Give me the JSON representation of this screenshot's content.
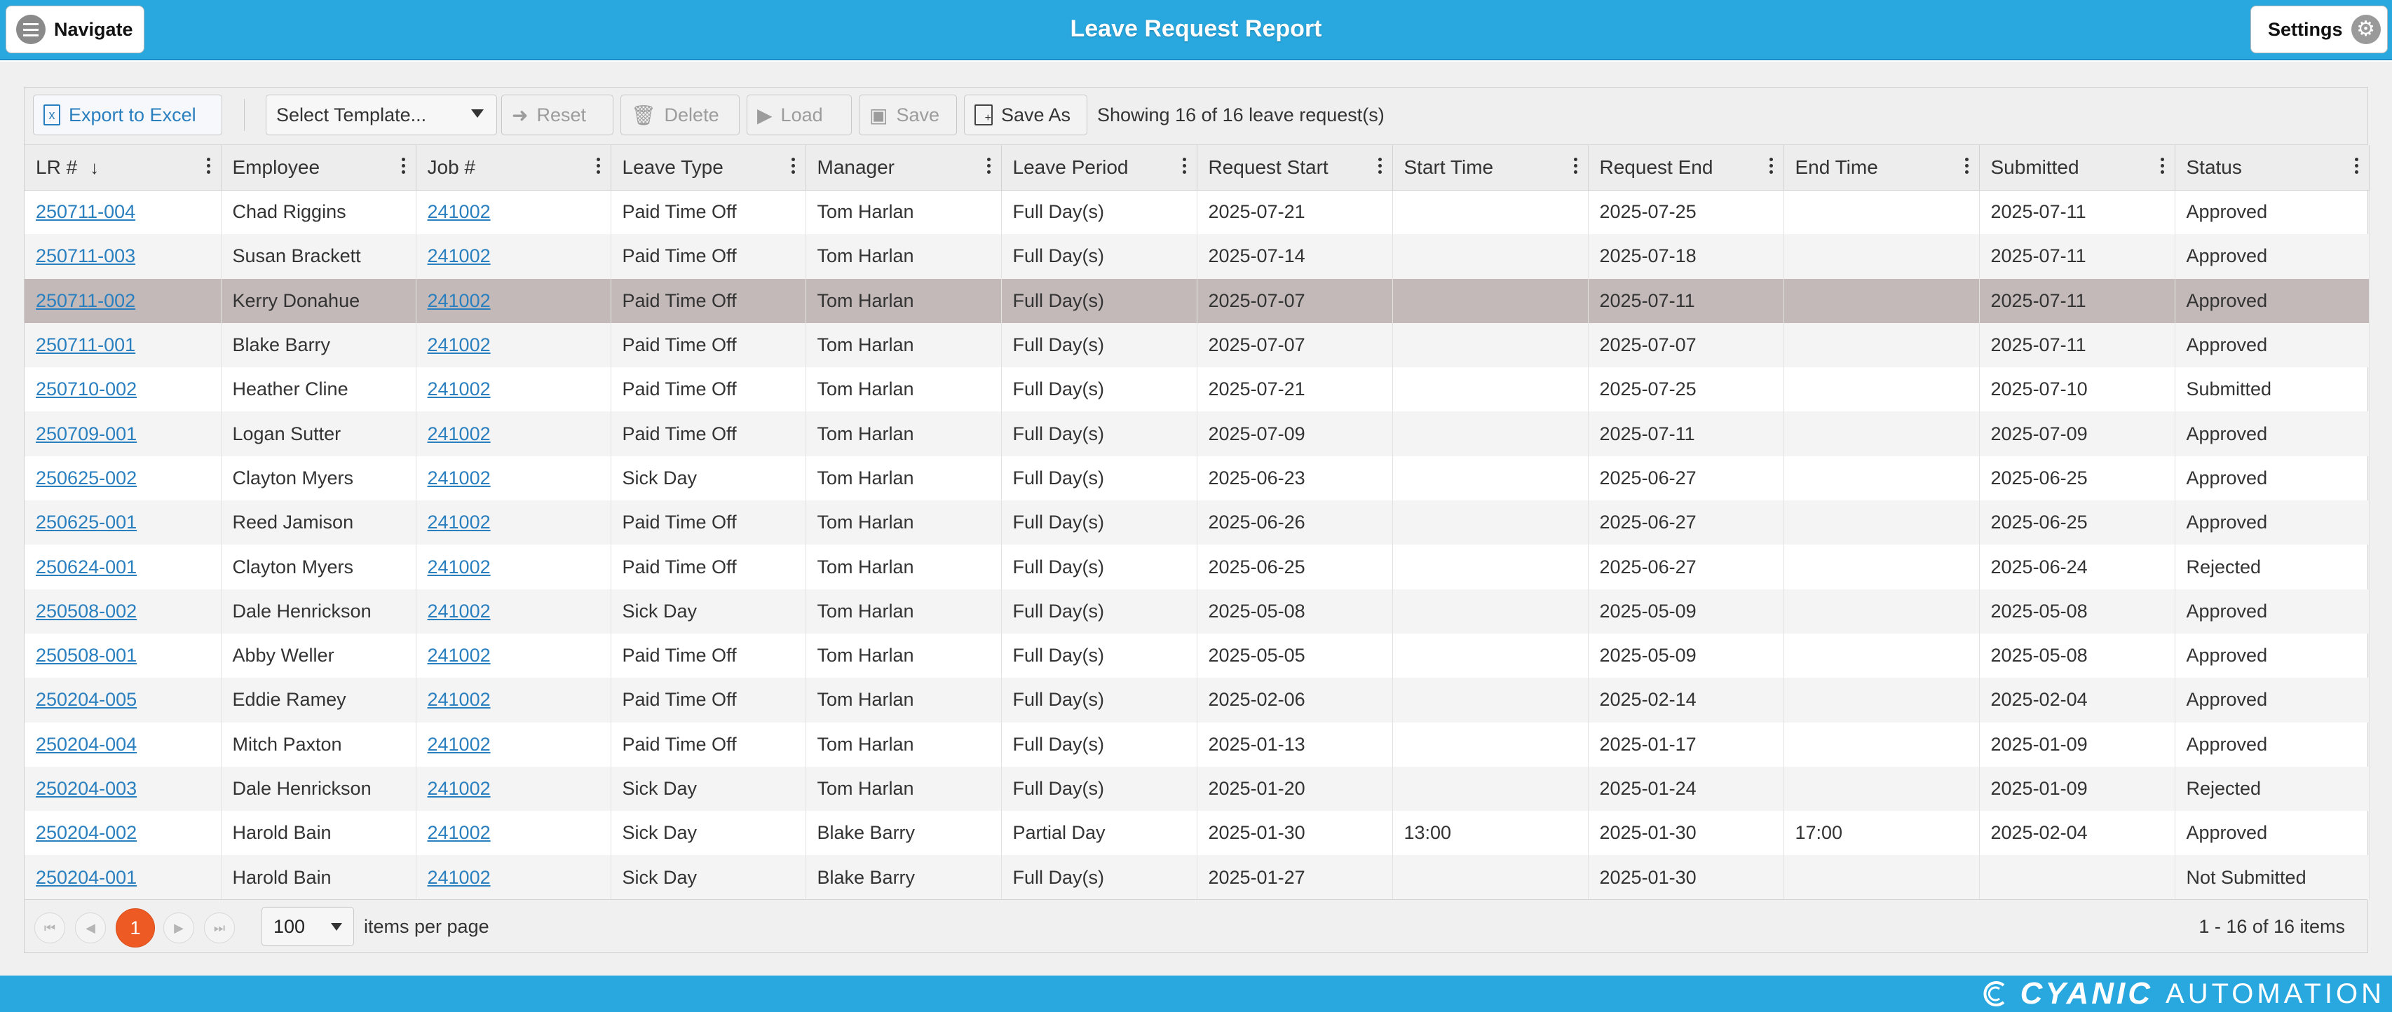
{
  "header": {
    "title": "Leave Request Report",
    "navigate_label": "Navigate",
    "settings_label": "Settings"
  },
  "toolbar": {
    "export_label": "Export to Excel",
    "template_placeholder": "Select Template...",
    "reset_label": "Reset",
    "delete_label": "Delete",
    "load_label": "Load",
    "save_label": "Save",
    "save_as_label": "Save As",
    "showing_text": "Showing 16 of 16 leave request(s)"
  },
  "columns": [
    "LR #",
    "Employee",
    "Job #",
    "Leave Type",
    "Manager",
    "Leave Period",
    "Request Start",
    "Start Time",
    "Request End",
    "End Time",
    "Submitted",
    "Status"
  ],
  "rows": [
    [
      "250711-004",
      "Chad Riggins",
      "241002",
      "Paid Time Off",
      "Tom Harlan",
      "Full Day(s)",
      "2025-07-21",
      "",
      "2025-07-25",
      "",
      "2025-07-11",
      "Approved"
    ],
    [
      "250711-003",
      "Susan Brackett",
      "241002",
      "Paid Time Off",
      "Tom Harlan",
      "Full Day(s)",
      "2025-07-14",
      "",
      "2025-07-18",
      "",
      "2025-07-11",
      "Approved"
    ],
    [
      "250711-002",
      "Kerry Donahue",
      "241002",
      "Paid Time Off",
      "Tom Harlan",
      "Full Day(s)",
      "2025-07-07",
      "",
      "2025-07-11",
      "",
      "2025-07-11",
      "Approved"
    ],
    [
      "250711-001",
      "Blake Barry",
      "241002",
      "Paid Time Off",
      "Tom Harlan",
      "Full Day(s)",
      "2025-07-07",
      "",
      "2025-07-07",
      "",
      "2025-07-11",
      "Approved"
    ],
    [
      "250710-002",
      "Heather Cline",
      "241002",
      "Paid Time Off",
      "Tom Harlan",
      "Full Day(s)",
      "2025-07-21",
      "",
      "2025-07-25",
      "",
      "2025-07-10",
      "Submitted"
    ],
    [
      "250709-001",
      "Logan Sutter",
      "241002",
      "Paid Time Off",
      "Tom Harlan",
      "Full Day(s)",
      "2025-07-09",
      "",
      "2025-07-11",
      "",
      "2025-07-09",
      "Approved"
    ],
    [
      "250625-002",
      "Clayton Myers",
      "241002",
      "Sick Day",
      "Tom Harlan",
      "Full Day(s)",
      "2025-06-23",
      "",
      "2025-06-27",
      "",
      "2025-06-25",
      "Approved"
    ],
    [
      "250625-001",
      "Reed Jamison",
      "241002",
      "Paid Time Off",
      "Tom Harlan",
      "Full Day(s)",
      "2025-06-26",
      "",
      "2025-06-27",
      "",
      "2025-06-25",
      "Approved"
    ],
    [
      "250624-001",
      "Clayton Myers",
      "241002",
      "Paid Time Off",
      "Tom Harlan",
      "Full Day(s)",
      "2025-06-25",
      "",
      "2025-06-27",
      "",
      "2025-06-24",
      "Rejected"
    ],
    [
      "250508-002",
      "Dale Henrickson",
      "241002",
      "Sick Day",
      "Tom Harlan",
      "Full Day(s)",
      "2025-05-08",
      "",
      "2025-05-09",
      "",
      "2025-05-08",
      "Approved"
    ],
    [
      "250508-001",
      "Abby Weller",
      "241002",
      "Paid Time Off",
      "Tom Harlan",
      "Full Day(s)",
      "2025-05-05",
      "",
      "2025-05-09",
      "",
      "2025-05-08",
      "Approved"
    ],
    [
      "250204-005",
      "Eddie Ramey",
      "241002",
      "Paid Time Off",
      "Tom Harlan",
      "Full Day(s)",
      "2025-02-06",
      "",
      "2025-02-14",
      "",
      "2025-02-04",
      "Approved"
    ],
    [
      "250204-004",
      "Mitch Paxton",
      "241002",
      "Paid Time Off",
      "Tom Harlan",
      "Full Day(s)",
      "2025-01-13",
      "",
      "2025-01-17",
      "",
      "2025-01-09",
      "Approved"
    ],
    [
      "250204-003",
      "Dale Henrickson",
      "241002",
      "Sick Day",
      "Tom Harlan",
      "Full Day(s)",
      "2025-01-20",
      "",
      "2025-01-24",
      "",
      "2025-01-09",
      "Rejected"
    ],
    [
      "250204-002",
      "Harold Bain",
      "241002",
      "Sick Day",
      "Blake Barry",
      "Partial Day",
      "2025-01-30",
      "13:00",
      "2025-01-30",
      "17:00",
      "2025-02-04",
      "Approved"
    ],
    [
      "250204-001",
      "Harold Bain",
      "241002",
      "Sick Day",
      "Blake Barry",
      "Full Day(s)",
      "2025-01-27",
      "",
      "2025-01-30",
      "",
      "",
      "Not Submitted"
    ]
  ],
  "selected_row_index": 2,
  "pager": {
    "current_page": "1",
    "page_size": "100",
    "items_per_page_label": "items per page",
    "info": "1 - 16 of 16 items"
  },
  "footer": {
    "brand_main": "CYANIC",
    "brand_sub": "AUTOMATION"
  },
  "colors": {
    "header_blue": "#29a8e0",
    "link_blue": "#2a7fbf",
    "selected_row": "#c3b9b9",
    "current_page": "#ee5a24"
  }
}
